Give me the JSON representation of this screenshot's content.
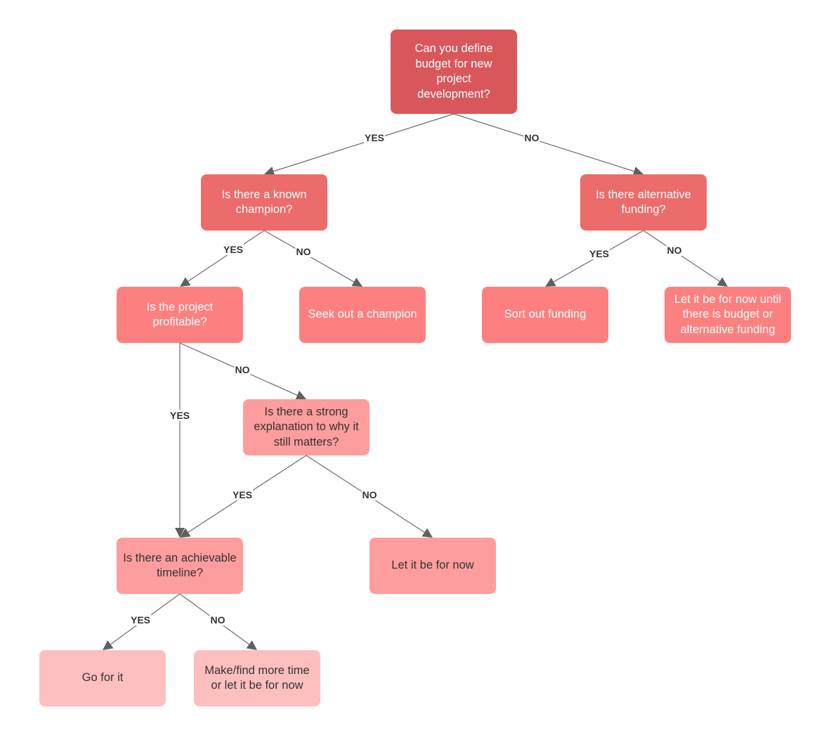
{
  "diagram": {
    "type": "decision-tree flowchart",
    "nodes": [
      {
        "id": "q-budget",
        "text": "Can you define budget for new project development?",
        "level": 0,
        "fill": "#d9575b",
        "text_color": "#ffffff"
      },
      {
        "id": "q-champion",
        "text": "Is there a known champion?",
        "level": 1,
        "fill": "#ec6b6b",
        "text_color": "#ffffff"
      },
      {
        "id": "q-alt-funding",
        "text": "Is there alternative funding?",
        "level": 1,
        "fill": "#ec6b6b",
        "text_color": "#ffffff"
      },
      {
        "id": "q-profitable",
        "text": "Is the project profitable?",
        "level": 2,
        "fill": "#fd8080",
        "text_color": "#ffffff"
      },
      {
        "id": "a-seek-champion",
        "text": "Seek out a champion",
        "level": 2,
        "fill": "#fd8080",
        "text_color": "#ffffff"
      },
      {
        "id": "a-sort-funding",
        "text": "Sort out funding",
        "level": 2,
        "fill": "#fd8080",
        "text_color": "#ffffff"
      },
      {
        "id": "a-wait-budget",
        "text": "Let it be for now until there is budget or alternative funding",
        "level": 2,
        "fill": "#fd8080",
        "text_color": "#ffffff"
      },
      {
        "id": "q-explanation",
        "text": "Is there a strong explanation to why it still matters?",
        "level": 3,
        "fill": "#fe9d9d",
        "text_color": "#333333"
      },
      {
        "id": "q-timeline",
        "text": "Is there an achievable timeline?",
        "level": 4,
        "fill": "#fe9d9d",
        "text_color": "#333333"
      },
      {
        "id": "a-let-be",
        "text": "Let it be for now",
        "level": 4,
        "fill": "#fe9d9d",
        "text_color": "#333333"
      },
      {
        "id": "a-go",
        "text": "Go for it",
        "level": 5,
        "fill": "#ffbfbf",
        "text_color": "#333333"
      },
      {
        "id": "a-more-time",
        "text": "Make/find more time or let it be for now",
        "level": 5,
        "fill": "#ffbfbf",
        "text_color": "#333333"
      }
    ],
    "edges": [
      {
        "from": "q-budget",
        "to": "q-champion",
        "label": "YES"
      },
      {
        "from": "q-budget",
        "to": "q-alt-funding",
        "label": "NO"
      },
      {
        "from": "q-champion",
        "to": "q-profitable",
        "label": "YES"
      },
      {
        "from": "q-champion",
        "to": "a-seek-champion",
        "label": "NO"
      },
      {
        "from": "q-alt-funding",
        "to": "a-sort-funding",
        "label": "YES"
      },
      {
        "from": "q-alt-funding",
        "to": "a-wait-budget",
        "label": "NO"
      },
      {
        "from": "q-profitable",
        "to": "q-timeline",
        "label": "YES"
      },
      {
        "from": "q-profitable",
        "to": "q-explanation",
        "label": "NO"
      },
      {
        "from": "q-explanation",
        "to": "q-timeline",
        "label": "YES"
      },
      {
        "from": "q-explanation",
        "to": "a-let-be",
        "label": "NO"
      },
      {
        "from": "q-timeline",
        "to": "a-go",
        "label": "YES"
      },
      {
        "from": "q-timeline",
        "to": "a-more-time",
        "label": "NO"
      }
    ],
    "colors": {
      "line": "#6b6b6b",
      "arrow": "#5f5f5f",
      "label_text": "#333333"
    }
  }
}
